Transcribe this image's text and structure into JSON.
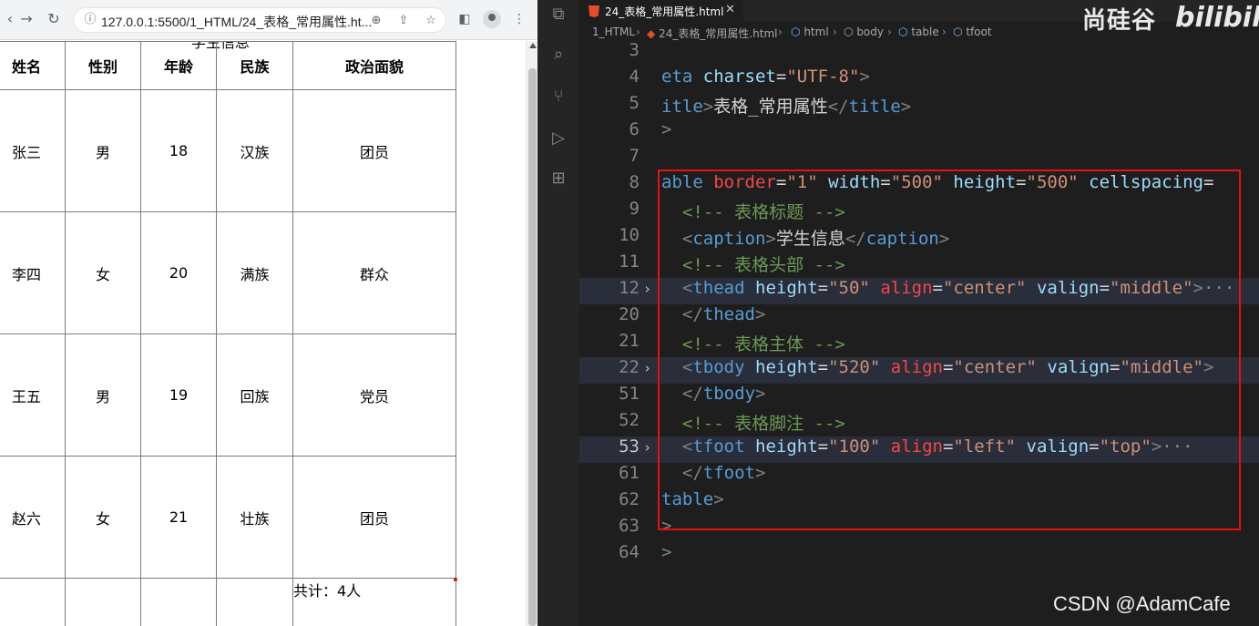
{
  "browser": {
    "url": "127.0.0.1:5500/1_HTML/24_表格_常用属性.ht...",
    "table": {
      "caption": "学生信息",
      "headers": [
        "姓名",
        "性别",
        "年龄",
        "民族",
        "政治面貌"
      ],
      "rows": [
        [
          "张三",
          "男",
          "18",
          "汉族",
          "团员"
        ],
        [
          "李四",
          "女",
          "20",
          "满族",
          "群众"
        ],
        [
          "王五",
          "男",
          "19",
          "回族",
          "党员"
        ],
        [
          "赵六",
          "女",
          "21",
          "壮族",
          "团员"
        ]
      ],
      "footer": "共计：4人"
    }
  },
  "vscode": {
    "tab_label": "24_表格_常用属性.html",
    "breadcrumbs": [
      "1_HTML",
      "24_表格_常用属性.html",
      "html",
      "body",
      "table",
      "tfoot"
    ],
    "lines": [
      {
        "n": "3",
        "tokens": []
      },
      {
        "n": "4",
        "tokens": [
          [
            "t-tag",
            "eta"
          ],
          [
            "t-txt",
            " "
          ],
          [
            "t-attr",
            "charset"
          ],
          [
            "t-eq",
            "="
          ],
          [
            "t-str",
            "\"UTF-8\""
          ],
          [
            "t-br",
            ">"
          ]
        ]
      },
      {
        "n": "5",
        "tokens": [
          [
            "t-tag",
            "itle"
          ],
          [
            "t-br",
            ">"
          ],
          [
            "t-txt",
            "表格_常用属性"
          ],
          [
            "t-br",
            "</"
          ],
          [
            "t-tag",
            "title"
          ],
          [
            "t-br",
            ">"
          ]
        ]
      },
      {
        "n": "6",
        "tokens": [
          [
            "t-br",
            ">"
          ]
        ]
      },
      {
        "n": "7",
        "tokens": []
      },
      {
        "n": "8",
        "tokens": [
          [
            "t-tag",
            "able"
          ],
          [
            "t-txt",
            " "
          ],
          [
            "t-al",
            "border"
          ],
          [
            "t-eq",
            "="
          ],
          [
            "t-str",
            "\"1\""
          ],
          [
            "t-txt",
            " "
          ],
          [
            "t-attr",
            "width"
          ],
          [
            "t-eq",
            "="
          ],
          [
            "t-str",
            "\"500\""
          ],
          [
            "t-txt",
            " "
          ],
          [
            "t-attr",
            "height"
          ],
          [
            "t-eq",
            "="
          ],
          [
            "t-str",
            "\"500\""
          ],
          [
            "t-txt",
            " "
          ],
          [
            "t-attr",
            "cellspacing"
          ],
          [
            "t-eq",
            "="
          ]
        ]
      },
      {
        "n": "9",
        "tokens": [
          [
            "t-txt",
            "  "
          ],
          [
            "t-cmt",
            "<!-- 表格标题 -->"
          ]
        ]
      },
      {
        "n": "10",
        "tokens": [
          [
            "t-txt",
            "  "
          ],
          [
            "t-br",
            "<"
          ],
          [
            "t-tag",
            "caption"
          ],
          [
            "t-br",
            ">"
          ],
          [
            "t-txt",
            "学生信息"
          ],
          [
            "t-br",
            "</"
          ],
          [
            "t-tag",
            "caption"
          ],
          [
            "t-br",
            ">"
          ]
        ]
      },
      {
        "n": "11",
        "tokens": [
          [
            "t-txt",
            "  "
          ],
          [
            "t-cmt",
            "<!-- 表格头部 -->"
          ]
        ]
      },
      {
        "n": "12",
        "fold": true,
        "hl": true,
        "tokens": [
          [
            "t-txt",
            "  "
          ],
          [
            "t-br",
            "<"
          ],
          [
            "t-tag",
            "thead"
          ],
          [
            "t-txt",
            " "
          ],
          [
            "t-attr",
            "height"
          ],
          [
            "t-eq",
            "="
          ],
          [
            "t-str",
            "\"50\""
          ],
          [
            "t-txt",
            " "
          ],
          [
            "t-al",
            "align"
          ],
          [
            "t-eq",
            "="
          ],
          [
            "t-str",
            "\"center\""
          ],
          [
            "t-txt",
            " "
          ],
          [
            "t-attr",
            "valign"
          ],
          [
            "t-eq",
            "="
          ],
          [
            "t-str",
            "\"middle\""
          ],
          [
            "t-br",
            ">"
          ],
          [
            "t-ell",
            "···"
          ]
        ]
      },
      {
        "n": "20",
        "tokens": [
          [
            "t-txt",
            "  "
          ],
          [
            "t-br",
            "</"
          ],
          [
            "t-tag",
            "thead"
          ],
          [
            "t-br",
            ">"
          ]
        ]
      },
      {
        "n": "21",
        "tokens": [
          [
            "t-txt",
            "  "
          ],
          [
            "t-cmt",
            "<!-- 表格主体 -->"
          ]
        ]
      },
      {
        "n": "22",
        "fold": true,
        "hl": true,
        "tokens": [
          [
            "t-txt",
            "  "
          ],
          [
            "t-br",
            "<"
          ],
          [
            "t-tag",
            "tbody"
          ],
          [
            "t-txt",
            " "
          ],
          [
            "t-attr",
            "height"
          ],
          [
            "t-eq",
            "="
          ],
          [
            "t-str",
            "\"520\""
          ],
          [
            "t-txt",
            " "
          ],
          [
            "t-al",
            "align"
          ],
          [
            "t-eq",
            "="
          ],
          [
            "t-str",
            "\"center\""
          ],
          [
            "t-txt",
            " "
          ],
          [
            "t-attr",
            "valign"
          ],
          [
            "t-eq",
            "="
          ],
          [
            "t-str",
            "\"middle\""
          ],
          [
            "t-br",
            ">"
          ]
        ]
      },
      {
        "n": "51",
        "tokens": [
          [
            "t-txt",
            "  "
          ],
          [
            "t-br",
            "</"
          ],
          [
            "t-tag",
            "tbody"
          ],
          [
            "t-br",
            ">"
          ]
        ]
      },
      {
        "n": "52",
        "tokens": [
          [
            "t-txt",
            "  "
          ],
          [
            "t-cmt",
            "<!-- 表格脚注 -->"
          ]
        ]
      },
      {
        "n": "53",
        "fold": true,
        "hl": true,
        "cur": true,
        "tokens": [
          [
            "t-txt",
            "  "
          ],
          [
            "t-br",
            "<"
          ],
          [
            "t-tag",
            "tfoot"
          ],
          [
            "t-txt",
            " "
          ],
          [
            "t-attr",
            "height"
          ],
          [
            "t-eq",
            "="
          ],
          [
            "t-str",
            "\"100\""
          ],
          [
            "t-txt",
            " "
          ],
          [
            "t-al",
            "align"
          ],
          [
            "t-eq",
            "="
          ],
          [
            "t-str",
            "\"left\""
          ],
          [
            "t-txt",
            " "
          ],
          [
            "t-attr",
            "valign"
          ],
          [
            "t-eq",
            "="
          ],
          [
            "t-str",
            "\"top\""
          ],
          [
            "t-br",
            ">"
          ],
          [
            "t-ell",
            "···"
          ]
        ]
      },
      {
        "n": "61",
        "tokens": [
          [
            "t-txt",
            "  "
          ],
          [
            "t-br",
            "</"
          ],
          [
            "t-tag",
            "tfoot"
          ],
          [
            "t-br",
            ">"
          ]
        ]
      },
      {
        "n": "62",
        "tokens": [
          [
            "t-tag",
            "table"
          ],
          [
            "t-br",
            ">"
          ]
        ]
      },
      {
        "n": "63",
        "tokens": [
          [
            "t-br",
            ">"
          ]
        ]
      },
      {
        "n": "64",
        "tokens": [
          [
            "t-br",
            ">"
          ]
        ]
      }
    ]
  },
  "watermark": {
    "brand": "尚硅谷",
    "logo": "bilibili",
    "credit": "CSDN @AdamCafe"
  },
  "colors": {
    "highlight_box": "#e81010",
    "editor_bg": "#1e1e1e",
    "tag": "#569cd6",
    "string": "#ce9178",
    "comment": "#6a9955"
  }
}
